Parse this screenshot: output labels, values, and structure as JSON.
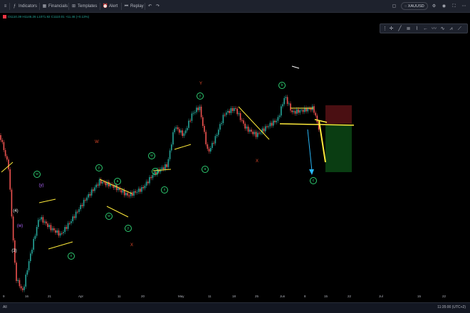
{
  "toolbar": {
    "indicators": "Indicators",
    "financials": "Financials",
    "templates": "Templates",
    "alert": "Alert",
    "replay": "Replay",
    "symbol": "XAUUSD"
  },
  "ohlc": "O1110.39  H1146.26  L1071.92  C1110.01  +11.46 (+0.13%)",
  "axis": {
    "x_ticks": [
      "9",
      "16",
      "21",
      "Apr",
      "11",
      "20",
      "May",
      "11",
      "18",
      "25",
      "Jun",
      "8",
      "15",
      "22",
      "Jul",
      "15",
      "22"
    ]
  },
  "wave_labels": [
    {
      "id": "w-main",
      "text": "w",
      "style": "circle",
      "color": "#2ecc71"
    },
    {
      "id": "y-paren",
      "text": "(y)",
      "style": "plain",
      "color": "#b266ff"
    },
    {
      "id": "w-paren",
      "text": "(w)",
      "style": "plain",
      "color": "#b266ff"
    },
    {
      "id": "4-paren",
      "text": "(4)",
      "style": "plain",
      "color": "#ffffff"
    },
    {
      "id": "3-paren",
      "text": "(3)",
      "style": "plain",
      "color": "#ffffff"
    },
    {
      "id": "x-1",
      "text": "x",
      "style": "circle",
      "color": "#2ecc71"
    },
    {
      "id": "y-1",
      "text": "y",
      "style": "circle",
      "color": "#2ecc71"
    },
    {
      "id": "w-red",
      "text": "W",
      "style": "plain",
      "color": "#e04a2a"
    },
    {
      "id": "a-1",
      "text": "a",
      "style": "circle",
      "color": "#2ecc71"
    },
    {
      "id": "w-2",
      "text": "w",
      "style": "circle",
      "color": "#2ecc71"
    },
    {
      "id": "y-2",
      "text": "y",
      "style": "circle",
      "color": "#2ecc71"
    },
    {
      "id": "x-red-1",
      "text": "X",
      "style": "plain",
      "color": "#e04a2a"
    },
    {
      "id": "w-3",
      "text": "w",
      "style": "circle",
      "color": "#2ecc71"
    },
    {
      "id": "x-2",
      "text": "x",
      "style": "circle",
      "color": "#2ecc71"
    },
    {
      "id": "x-3",
      "text": "x",
      "style": "circle",
      "color": "#2ecc71"
    },
    {
      "id": "y-red",
      "text": "Y",
      "style": "plain",
      "color": "#e04a2a"
    },
    {
      "id": "y-3",
      "text": "y",
      "style": "circle",
      "color": "#2ecc71"
    },
    {
      "id": "a-2",
      "text": "a",
      "style": "circle",
      "color": "#2ecc71"
    },
    {
      "id": "b-1",
      "text": "b",
      "style": "circle",
      "color": "#2ecc71"
    },
    {
      "id": "x-red-2",
      "text": "X",
      "style": "plain",
      "color": "#e04a2a"
    },
    {
      "id": "c-1",
      "text": "c",
      "style": "circle",
      "color": "#2ecc71"
    }
  ],
  "colors": {
    "background": "#000000",
    "candle_up": "#26a69a",
    "candle_down": "#ef5350",
    "trendline": "#ffeb3b",
    "wave_green": "#2ecc71",
    "target_arrow": "#29b6f6",
    "stop_zone": "#4a0f12",
    "target_zone": "#0a3d12"
  },
  "status": {
    "left_label": "All",
    "time": "11:35:00 (UTC+2)"
  }
}
